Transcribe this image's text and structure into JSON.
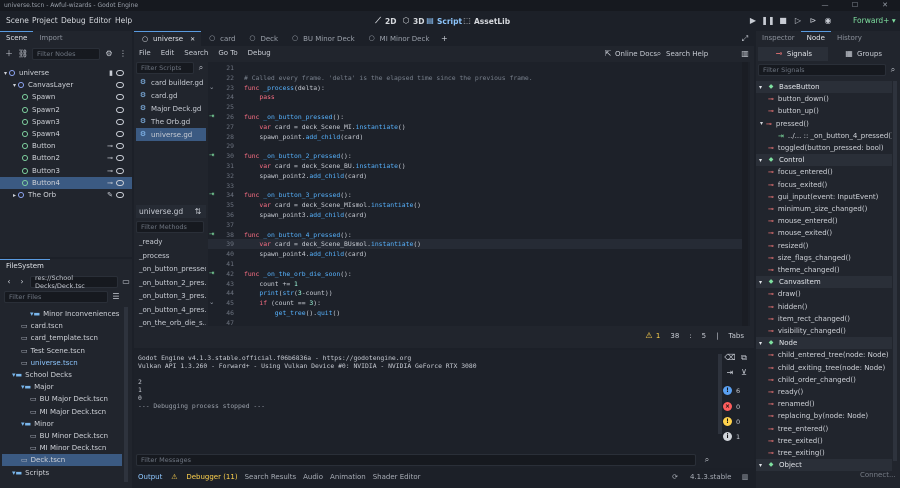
{
  "window": {
    "title": "universe.tscn - Awful-wizards - Godot Engine",
    "controls": [
      "—",
      "☐",
      "✕"
    ]
  },
  "menu": [
    "Scene",
    "Project",
    "Debug",
    "Editor",
    "Help"
  ],
  "workspaces": [
    {
      "label": "2D",
      "icon": "cube-2d-icon"
    },
    {
      "label": "3D",
      "icon": "cube-3d-icon"
    },
    {
      "label": "Script",
      "icon": "script-icon"
    },
    {
      "label": "AssetLib",
      "icon": "assetlib-icon"
    }
  ],
  "renderer": "Forward+",
  "scene_dock": {
    "tabs": [
      "Scene",
      "Import"
    ],
    "filter_placeholder": "Filter Nodes",
    "nodes": [
      {
        "label": "universe",
        "depth": 0,
        "kind": "root"
      },
      {
        "label": "CanvasLayer",
        "depth": 1,
        "kind": "n2d"
      },
      {
        "label": "Spawn",
        "depth": 2,
        "kind": "ctrl"
      },
      {
        "label": "Spawn2",
        "depth": 2,
        "kind": "ctrl"
      },
      {
        "label": "Spawn3",
        "depth": 2,
        "kind": "ctrl"
      },
      {
        "label": "Spawn4",
        "depth": 2,
        "kind": "ctrl"
      },
      {
        "label": "Button",
        "depth": 2,
        "kind": "ctrl"
      },
      {
        "label": "Button2",
        "depth": 2,
        "kind": "ctrl"
      },
      {
        "label": "Button3",
        "depth": 2,
        "kind": "ctrl"
      },
      {
        "label": "Button4",
        "depth": 2,
        "kind": "ctrl",
        "selected": true
      },
      {
        "label": "The Orb",
        "depth": 1,
        "kind": "n2d"
      }
    ]
  },
  "filesystem": {
    "tab": "FileSystem",
    "path": "res://School Decks/Deck.tsc",
    "filter_placeholder": "Filter Files",
    "items": [
      {
        "label": "Minor Inconveniences",
        "depth": 2,
        "type": "folder"
      },
      {
        "label": "card.tscn",
        "depth": 1,
        "type": "file"
      },
      {
        "label": "card_template.tscn",
        "depth": 1,
        "type": "file"
      },
      {
        "label": "Test Scene.tscn",
        "depth": 1,
        "type": "file"
      },
      {
        "label": "universe.tscn",
        "depth": 1,
        "type": "file",
        "highlight": true
      },
      {
        "label": "School Decks",
        "depth": 0,
        "type": "folder"
      },
      {
        "label": "Major",
        "depth": 1,
        "type": "folder"
      },
      {
        "label": "BU Major Deck.tscn",
        "depth": 2,
        "type": "file"
      },
      {
        "label": "MI Major Deck.tscn",
        "depth": 2,
        "type": "file"
      },
      {
        "label": "Minor",
        "depth": 1,
        "type": "folder"
      },
      {
        "label": "BU Minor Deck.tscn",
        "depth": 2,
        "type": "file"
      },
      {
        "label": "MI Minor Deck.tscn",
        "depth": 2,
        "type": "file"
      },
      {
        "label": "Deck.tscn",
        "depth": 1,
        "type": "file",
        "selected": true
      },
      {
        "label": "Scripts",
        "depth": 0,
        "type": "folder"
      }
    ]
  },
  "editor_tabs": [
    {
      "label": "universe",
      "active": true
    },
    {
      "label": "card"
    },
    {
      "label": "Deck"
    },
    {
      "label": "BU Minor Deck"
    },
    {
      "label": "MI Minor Deck"
    }
  ],
  "script_menu": [
    "File",
    "Edit",
    "Search",
    "Go To",
    "Debug"
  ],
  "script_toolbar": {
    "online_docs": "Online Docs",
    "search_help": "Search Help"
  },
  "scripts": {
    "filter_placeholder": "Filter Scripts",
    "items": [
      "card builder.gd",
      "card.gd",
      "Major Deck.gd",
      "The Orb.gd",
      "universe.gd"
    ],
    "selected": "universe.gd"
  },
  "methods": {
    "file": "universe.gd",
    "filter_placeholder": "Filter Methods",
    "items": [
      "_ready",
      "_process",
      "_on_button_pressed",
      "_on_button_2_pres...",
      "_on_button_3_pres...",
      "_on_button_4_pres...",
      "_on_the_orb_die_s..."
    ]
  },
  "code": [
    {
      "n": "21",
      "t": "",
      "mark": ""
    },
    {
      "n": "22",
      "t": "# Called every frame. 'delta' is the elapsed time since the previous frame.",
      "mark": "",
      "cls": "cm"
    },
    {
      "n": "23",
      "t": "func _process(delta):",
      "mark": "fold"
    },
    {
      "n": "24",
      "t": "    pass",
      "mark": ""
    },
    {
      "n": "25",
      "t": "",
      "mark": ""
    },
    {
      "n": "26",
      "t": "func _on_button_pressed():",
      "mark": "link"
    },
    {
      "n": "27",
      "t": "    var card = deck_Scene_MI.instantiate()",
      "mark": ""
    },
    {
      "n": "28",
      "t": "    spawn_point.add_child(card)",
      "mark": ""
    },
    {
      "n": "29",
      "t": "",
      "mark": ""
    },
    {
      "n": "30",
      "t": "func _on_button_2_pressed():",
      "mark": "link"
    },
    {
      "n": "31",
      "t": "    var card = deck_Scene_BU.instantiate()",
      "mark": ""
    },
    {
      "n": "32",
      "t": "    spawn_point2.add_child(card)",
      "mark": ""
    },
    {
      "n": "33",
      "t": "",
      "mark": ""
    },
    {
      "n": "34",
      "t": "func _on_button_3_pressed():",
      "mark": "link"
    },
    {
      "n": "35",
      "t": "    var card = deck_Scene_MIsmol.instantiate()",
      "mark": ""
    },
    {
      "n": "36",
      "t": "    spawn_point3.add_child(card)",
      "mark": ""
    },
    {
      "n": "37",
      "t": "",
      "mark": ""
    },
    {
      "n": "38",
      "t": "func _on_button_4_pressed():",
      "mark": "link"
    },
    {
      "n": "39",
      "t": "    var card = deck_Scene_BUsmol.instantiate()",
      "mark": "",
      "current": true
    },
    {
      "n": "40",
      "t": "    spawn_point4.add_child(card)",
      "mark": ""
    },
    {
      "n": "41",
      "t": "",
      "mark": ""
    },
    {
      "n": "42",
      "t": "func _on_the_orb_die_soon():",
      "mark": "link"
    },
    {
      "n": "43",
      "t": "    count += 1",
      "mark": ""
    },
    {
      "n": "44",
      "t": "    print(str(3-count))",
      "mark": ""
    },
    {
      "n": "45",
      "t": "    if (count == 3):",
      "mark": "fold"
    },
    {
      "n": "46",
      "t": "        get_tree().quit()",
      "mark": ""
    },
    {
      "n": "47",
      "t": "",
      "mark": ""
    }
  ],
  "status": {
    "warnings": "1",
    "line": "38",
    "col": "5",
    "indent": "Tabs"
  },
  "output": {
    "lines": [
      "Godot Engine v4.1.3.stable.official.f06b6836a - https://godotengine.org",
      "Vulkan API 1.3.260 - Forward+ - Using Vulkan Device #0: NVIDIA - NVIDIA GeForce RTX 3080",
      "",
      "2",
      "1",
      "0",
      "--- Debugging process stopped ---"
    ],
    "filter_placeholder": "Filter Messages",
    "counts": {
      "messages": "6",
      "errors": "0",
      "warnings": "0",
      "info": "1"
    }
  },
  "bottom_tabs": [
    "Output",
    "Debugger (11)",
    "Search Results",
    "Audio",
    "Animation",
    "Shader Editor"
  ],
  "version": "4.1.3.stable",
  "inspector": {
    "tabs": [
      "Inspector",
      "Node",
      "History"
    ],
    "subtabs": [
      "Signals",
      "Groups"
    ],
    "filter_placeholder": "Filter Signals",
    "rows": [
      {
        "label": "BaseButton",
        "cat": true
      },
      {
        "label": "button_down()"
      },
      {
        "label": "button_up()"
      },
      {
        "label": "pressed()",
        "expanded": true
      },
      {
        "label": "../... :: _on_button_4_pressed()",
        "connection": true
      },
      {
        "label": "toggled(button_pressed: bool)"
      },
      {
        "label": "Control",
        "cat": true
      },
      {
        "label": "focus_entered()"
      },
      {
        "label": "focus_exited()"
      },
      {
        "label": "gui_input(event: InputEvent)"
      },
      {
        "label": "minimum_size_changed()"
      },
      {
        "label": "mouse_entered()"
      },
      {
        "label": "mouse_exited()"
      },
      {
        "label": "resized()"
      },
      {
        "label": "size_flags_changed()"
      },
      {
        "label": "theme_changed()"
      },
      {
        "label": "CanvasItem",
        "cat": true
      },
      {
        "label": "draw()"
      },
      {
        "label": "hidden()"
      },
      {
        "label": "item_rect_changed()"
      },
      {
        "label": "visibility_changed()"
      },
      {
        "label": "Node",
        "cat": true
      },
      {
        "label": "child_entered_tree(node: Node)"
      },
      {
        "label": "child_exiting_tree(node: Node)"
      },
      {
        "label": "child_order_changed()"
      },
      {
        "label": "ready()"
      },
      {
        "label": "renamed()"
      },
      {
        "label": "replacing_by(node: Node)"
      },
      {
        "label": "tree_entered()"
      },
      {
        "label": "tree_exited()"
      },
      {
        "label": "tree_exiting()"
      },
      {
        "label": "Object",
        "cat": true
      }
    ],
    "connect_button": "Connect..."
  }
}
